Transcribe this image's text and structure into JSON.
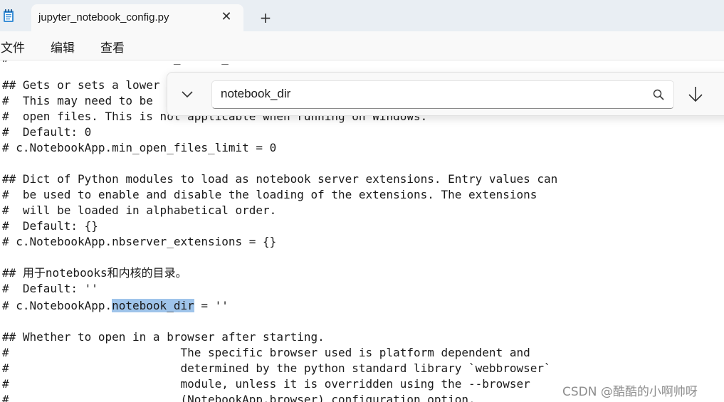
{
  "tab": {
    "title": "jupyter_notebook_config.py"
  },
  "menu": {
    "file": "文件",
    "edit": "编辑",
    "view": "查看"
  },
  "find": {
    "query": "notebook_dir"
  },
  "code": {
    "partial_top": "#                        _      _",
    "l1": "## Gets or sets a lower",
    "l2": "#  This may need to be",
    "l3": "#  open files. This is not applicable when running on Windows.",
    "l4": "#  Default: 0",
    "l5": "# c.NotebookApp.min_open_files_limit = 0",
    "l6": "## Dict of Python modules to load as notebook server extensions. Entry values can",
    "l7": "#  be used to enable and disable the loading of the extensions. The extensions",
    "l8": "#  will be loaded in alphabetical order.",
    "l9": "#  Default: {}",
    "l10": "# c.NotebookApp.nbserver_extensions = {}",
    "l11": "## 用于notebooks和内核的目录。",
    "l12": "#  Default: ''",
    "l13_prefix": "# c.NotebookApp.",
    "l13_match": "notebook_dir",
    "l13_suffix": " = ''",
    "l14": "## Whether to open in a browser after starting.",
    "l15": "#                         The specific browser used is platform dependent and",
    "l16": "#                         determined by the python standard library `webbrowser`",
    "l17": "#                         module, unless it is overridden using the --browser",
    "l18": "#                         (NotebookApp.browser) configuration option."
  },
  "watermark": "CSDN @酷酷的小啊帅呀",
  "icons": {
    "app": "notepad-icon",
    "close": "close-icon",
    "new_tab": "plus-icon",
    "expand": "chevron-down-icon",
    "search": "search-icon",
    "next": "arrow-down-icon"
  },
  "colors": {
    "highlight": "#9fc4ea",
    "tabbar": "#e9eef3",
    "editor_bg": "#ffffff"
  }
}
